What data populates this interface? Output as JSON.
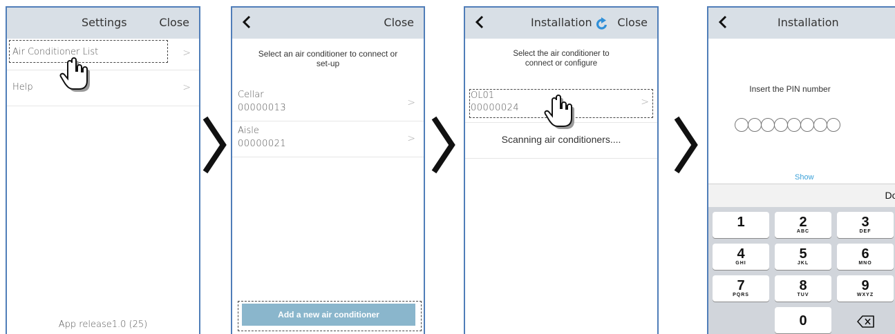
{
  "screen1": {
    "title": "Settings",
    "close_label": "Close",
    "items": [
      {
        "label": "Air Conditioner List"
      },
      {
        "label": "Help"
      }
    ],
    "footer": "App release1.0 (25)"
  },
  "screen2": {
    "close_label": "Close",
    "prompt": "Select an air conditioner to connect or set-up",
    "devices": [
      {
        "name": "Cellar",
        "serial": "00000013"
      },
      {
        "name": "Aisle",
        "serial": "00000021"
      }
    ],
    "add_button": "Add a new air conditioner"
  },
  "screen3": {
    "title": "Installation",
    "close_label": "Close",
    "prompt": "Select the air conditioner to connect or configure",
    "devices": [
      {
        "name": "OL01",
        "serial": "00000024"
      }
    ],
    "scanning": "Scanning air conditioners...."
  },
  "screen4": {
    "title": "Installation",
    "prompt": "Insert the PIN number",
    "pin_length": 8,
    "show_label": "Show",
    "done_label": "Done",
    "keypad": [
      {
        "num": "1",
        "letters": ""
      },
      {
        "num": "2",
        "letters": "ABC"
      },
      {
        "num": "3",
        "letters": "DEF"
      },
      {
        "num": "4",
        "letters": "GHI"
      },
      {
        "num": "5",
        "letters": "JKL"
      },
      {
        "num": "6",
        "letters": "MNO"
      },
      {
        "num": "7",
        "letters": "PQRS"
      },
      {
        "num": "8",
        "letters": "TUV"
      },
      {
        "num": "9",
        "letters": "WXYZ"
      },
      {
        "num": "0",
        "letters": ""
      }
    ]
  },
  "icons": {
    "back": "chevron-left-icon",
    "chevron": "chevron-right-icon",
    "flow_arrow": "flow-arrow-icon",
    "pointer": "hand-pointer-icon",
    "refresh": "refresh-icon",
    "backspace": "backspace-icon"
  },
  "colors": {
    "header_bg": "#d8dfe6",
    "frame_border": "#4f7db8",
    "add_button_bg": "#8ab6cc",
    "show_link": "#3aa0d8",
    "refresh_icon": "#2f8fd8",
    "keypad_bg": "#d1d5db"
  }
}
